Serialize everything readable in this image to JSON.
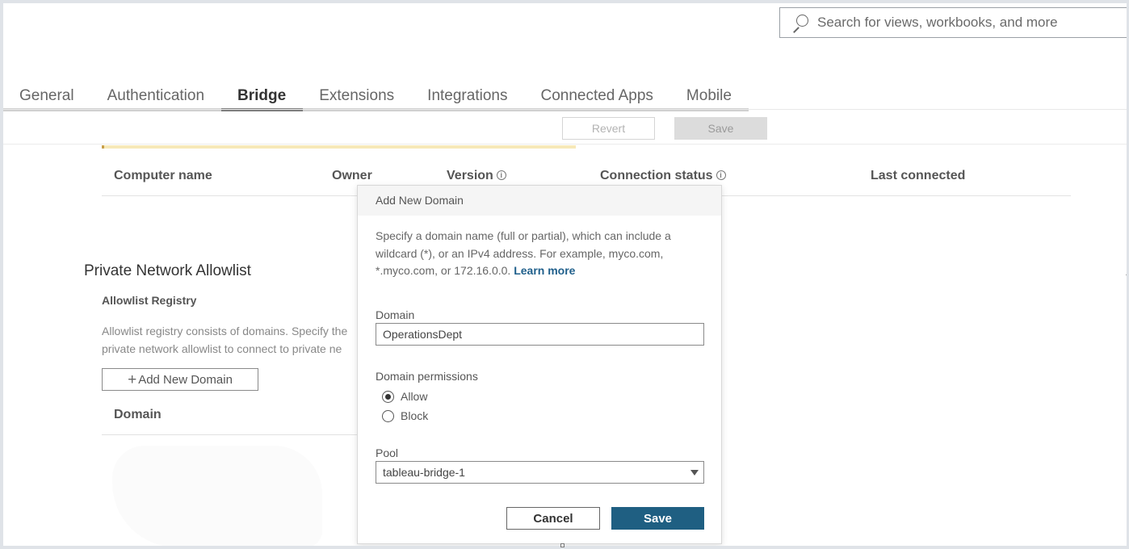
{
  "search": {
    "placeholder": "Search for views, workbooks, and more",
    "icon": "search-icon"
  },
  "tabs": [
    {
      "label": "General",
      "active": false
    },
    {
      "label": "Authentication",
      "active": false
    },
    {
      "label": "Bridge",
      "active": true
    },
    {
      "label": "Extensions",
      "active": false
    },
    {
      "label": "Integrations",
      "active": false
    },
    {
      "label": "Connected Apps",
      "active": false
    },
    {
      "label": "Mobile",
      "active": false
    }
  ],
  "toolbar": {
    "revert_label": "Revert",
    "save_label": "Save"
  },
  "clients_table": {
    "columns": [
      "Computer name",
      "Owner",
      "Version",
      "Connection status",
      "Last connected"
    ]
  },
  "allowlist": {
    "title": "Private Network Allowlist",
    "registry_title": "Allowlist Registry",
    "description_line1": "Allowlist registry consists of domains. Specify the",
    "description_line2": "private network allowlist to connect to private ne",
    "add_button_label": "Add New Domain",
    "domain_column": "Domain"
  },
  "dialog": {
    "title": "Add New Domain",
    "description": "Specify a domain name (full or partial), which can include a wildcard (*), or an IPv4 address. For example, myco.com, *.myco.com, or 172.16.0.0.",
    "learn_more": "Learn more",
    "domain_label": "Domain",
    "domain_value": "OperationsDept",
    "permissions_label": "Domain permissions",
    "permission_options": [
      {
        "label": "Allow",
        "selected": true
      },
      {
        "label": "Block",
        "selected": false
      }
    ],
    "pool_label": "Pool",
    "pool_value": "tableau-bridge-1",
    "cancel_label": "Cancel",
    "save_label": "Save"
  },
  "colors": {
    "primary_button": "#1f5f82",
    "link": "#1f5f8b",
    "notice": "#f7e9b8"
  }
}
